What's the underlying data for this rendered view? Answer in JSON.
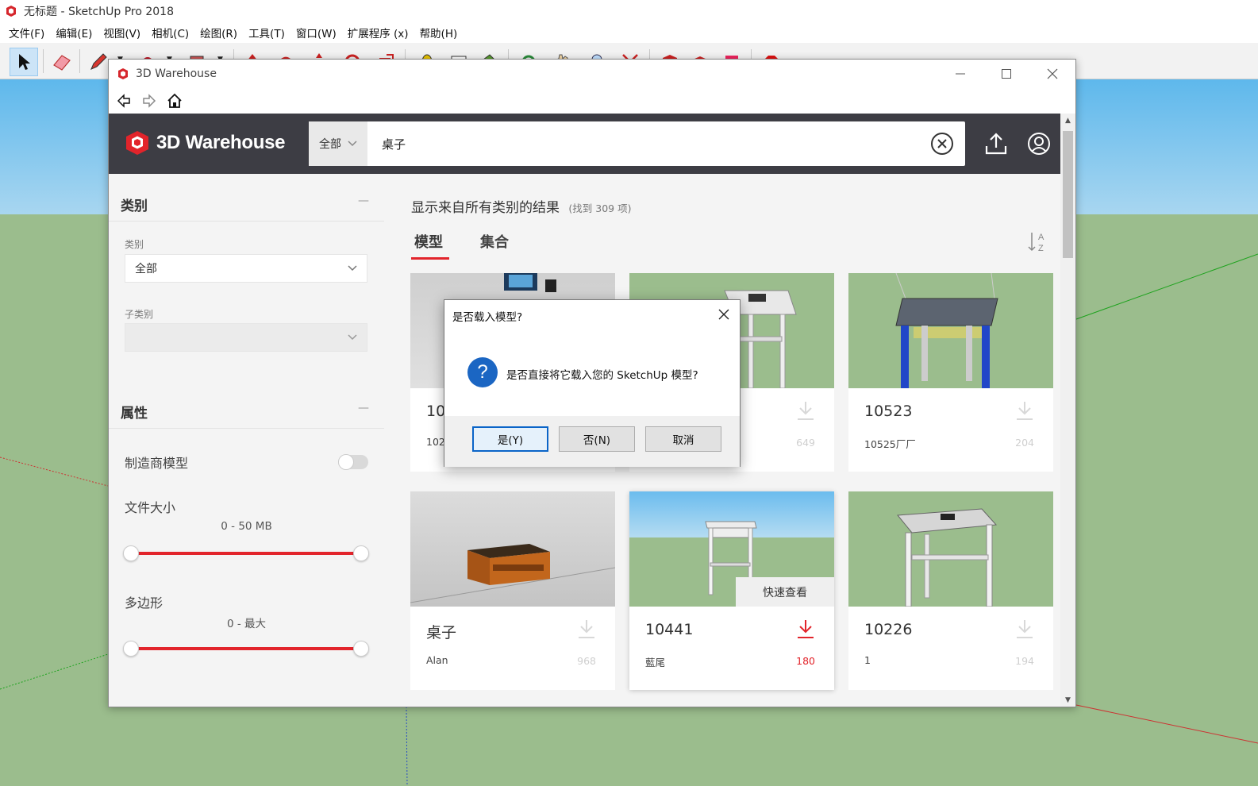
{
  "app": {
    "title": "无标题 - SketchUp Pro 2018",
    "menu": [
      "文件(F)",
      "编辑(E)",
      "视图(V)",
      "相机(C)",
      "绘图(R)",
      "工具(T)",
      "窗口(W)",
      "扩展程序 (x)",
      "帮助(H)"
    ]
  },
  "warehouse_window": {
    "title": "3D Warehouse",
    "logo_text": "3D Warehouse",
    "search": {
      "scope": "全部",
      "query": "桌子"
    }
  },
  "sidebar": {
    "category_section": "类别",
    "category_label": "类别",
    "category_value": "全部",
    "subcategory_label": "子类别",
    "subcategory_value": "",
    "attributes_section": "属性",
    "manufacturer_label": "制造商模型",
    "file_size_label": "文件大小",
    "file_size_range": "0 - 50 MB",
    "polygons_label": "多边形",
    "polygons_range": "0 - 最大",
    "collapse_symbol": "—"
  },
  "results": {
    "heading": "显示来自所有类别的结果",
    "count": "(找到 309 项)",
    "tabs": [
      "模型",
      "集合"
    ],
    "quick_view": "快速查看",
    "cards": [
      {
        "name": "10",
        "author": "102",
        "count": ""
      },
      {
        "name": "",
        "author": "",
        "count": "649"
      },
      {
        "name": "10523",
        "author": "10525厂厂",
        "count": "204"
      },
      {
        "name": "桌子",
        "author": "Alan",
        "count": "968"
      },
      {
        "name": "10441",
        "author": "藍尾",
        "count": "180"
      },
      {
        "name": "10226",
        "author": "1",
        "count": "194"
      }
    ]
  },
  "dialog": {
    "title": "是否载入模型?",
    "icon": "?",
    "message": "是否直接将它载入您的 SketchUp 模型?",
    "yes": "是(Y)",
    "no": "否(N)",
    "cancel": "取消"
  },
  "colors": {
    "accent": "#e2242b",
    "header": "#3d3d44",
    "dialog_icon": "#1b66c3"
  }
}
